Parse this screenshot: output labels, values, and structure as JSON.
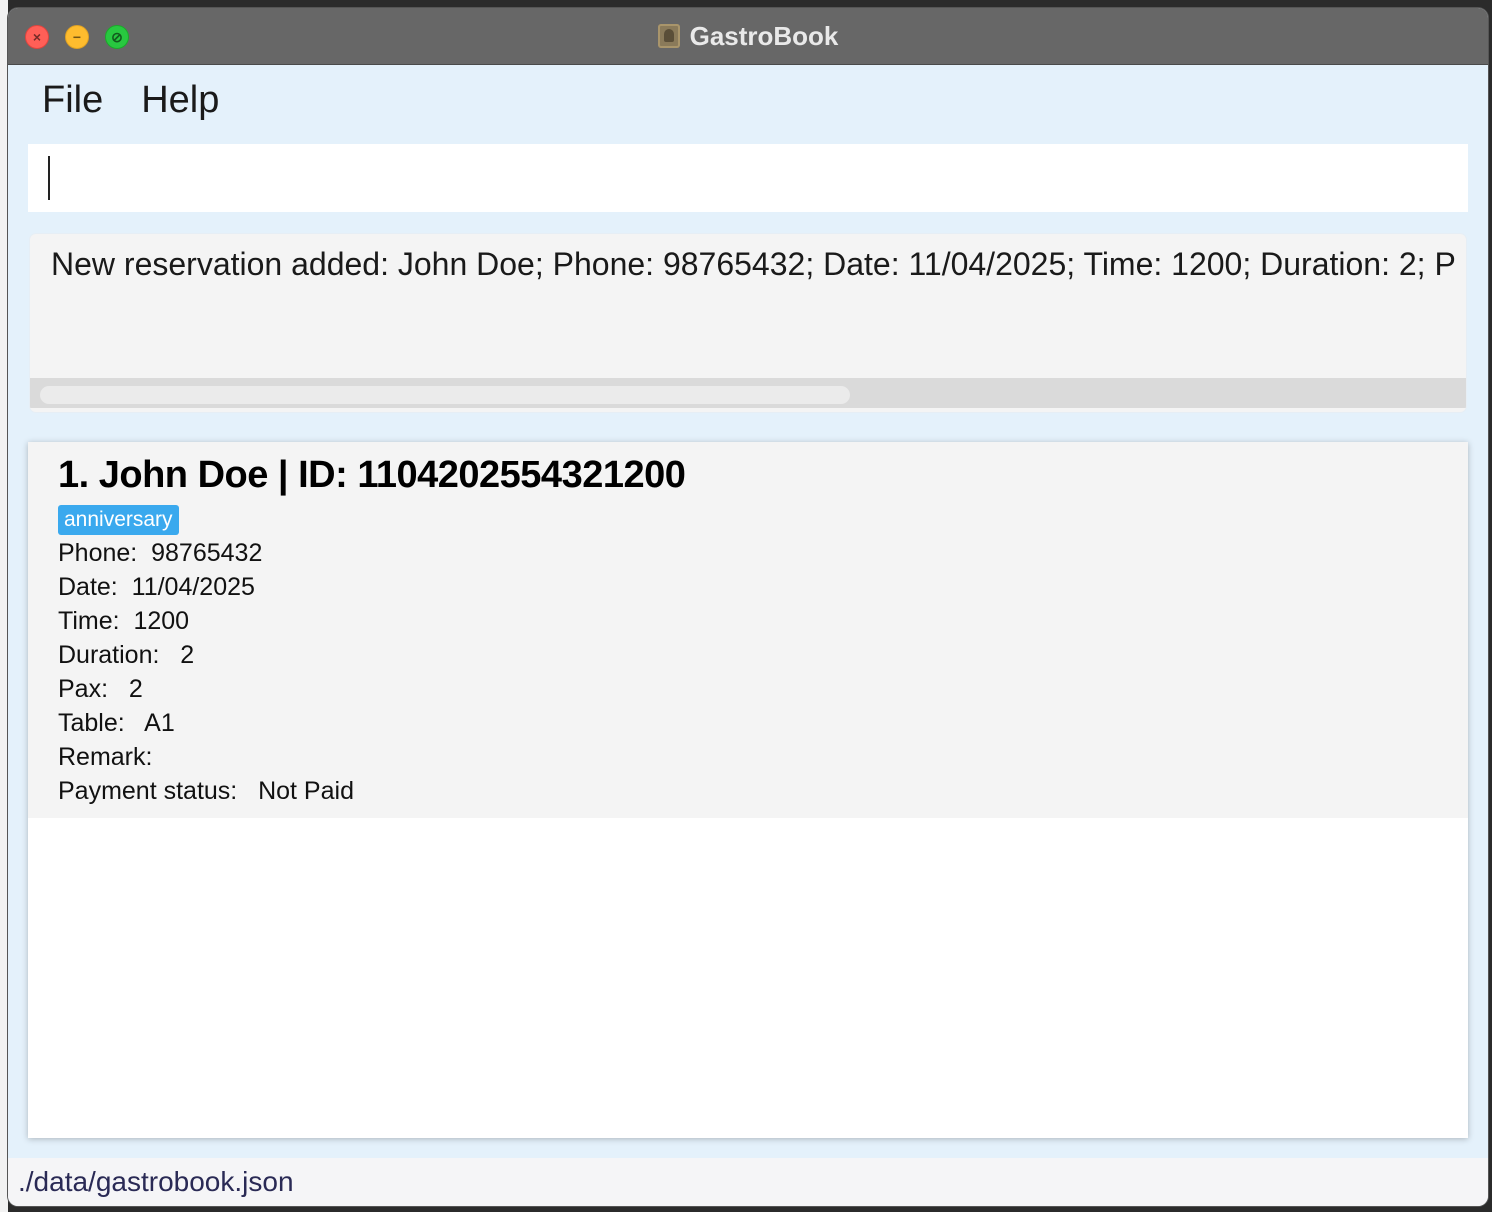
{
  "window": {
    "title": "GastroBook"
  },
  "menu": {
    "items": [
      "File",
      "Help"
    ]
  },
  "command": {
    "value": "",
    "placeholder": ""
  },
  "result": {
    "message": "New reservation added: John Doe; Phone: 98765432; Date: 11/04/2025; Time: 1200; Duration: 2; P"
  },
  "reservations": [
    {
      "title": "1. John Doe | ID: 1104202554321200",
      "tag": "anniversary",
      "phone_label": "Phone:  98765432",
      "date_label": "Date:  11/04/2025",
      "time_label": "Time:  1200",
      "duration_label": "Duration:   2",
      "pax_label": "Pax:   2",
      "table_label": "Table:   A1",
      "remark_label": "Remark:",
      "payment_label": "Payment status:   Not Paid"
    }
  ],
  "status": {
    "file_path": "./data/gastrobook.json"
  },
  "colors": {
    "tag": "#3aa9ee",
    "background": "#e4f1fb",
    "titlebar": "#676767"
  }
}
